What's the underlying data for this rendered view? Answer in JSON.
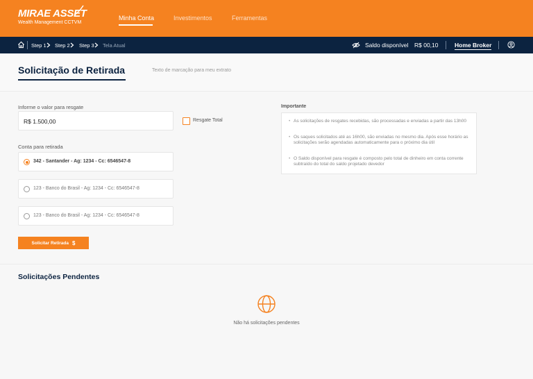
{
  "brand": {
    "name": "MIRAE ASSET",
    "subtitle": "Wealth Management CCTVM"
  },
  "nav": {
    "tabs": [
      {
        "label": "Minha Conta",
        "active": true
      },
      {
        "label": "Investimentos",
        "active": false
      },
      {
        "label": "Ferramentas",
        "active": false
      }
    ]
  },
  "breadcrumb": {
    "items": [
      "Step 1",
      "Step 2",
      "Step 3"
    ],
    "current": "Tela Atual"
  },
  "account_bar": {
    "balance_label": "Saldo disponível",
    "balance_value": "R$ 00,10",
    "home_broker": "Home Broker"
  },
  "page": {
    "title": "Solicitação de Retirada",
    "statement_text": "Texto de marcação para meu extrato"
  },
  "form": {
    "amount_label": "Informe o valor para resgate",
    "amount_value": "R$ 1.500,00",
    "total_checkbox_label": "Resgate Total",
    "accounts_label": "Conta para retirada",
    "accounts": [
      {
        "label": "342 - Santander - Ag: 1234 - Cc: 6546547-8",
        "selected": true
      },
      {
        "label": "123 - Banco do Brasil - Ag: 1234 - Cc: 6546547-8",
        "selected": false
      },
      {
        "label": "123 - Banco do Brasil - Ag: 1234 - Cc: 6546547-8",
        "selected": false
      }
    ],
    "submit_label": "Solicitar Retirada",
    "submit_icon": "$"
  },
  "important": {
    "title": "Importante",
    "items": [
      "As solicitações de resgates recebidas, são processadas e enviadas a partir das 13h00",
      "Os saques solicitados até as 16h00, são enviadas no mesmo dia. Após esse horário as solicitações serão agendadas automaticamente para o próximo dia útil",
      "O Saldo disponível para resgate é composto pelo total de dinheiro em conta corrente subtraído do total do saldo projetado devedor"
    ]
  },
  "pending": {
    "title": "Solicitações Pendentes",
    "empty_text": "Não há solicitações pendentes"
  },
  "colors": {
    "brand_orange": "#f58220",
    "navy": "#0c2340"
  },
  "icons": [
    "home-icon",
    "chevron-right-icon",
    "eye-off-icon",
    "user-icon",
    "dollar-icon",
    "globe-icon"
  ]
}
